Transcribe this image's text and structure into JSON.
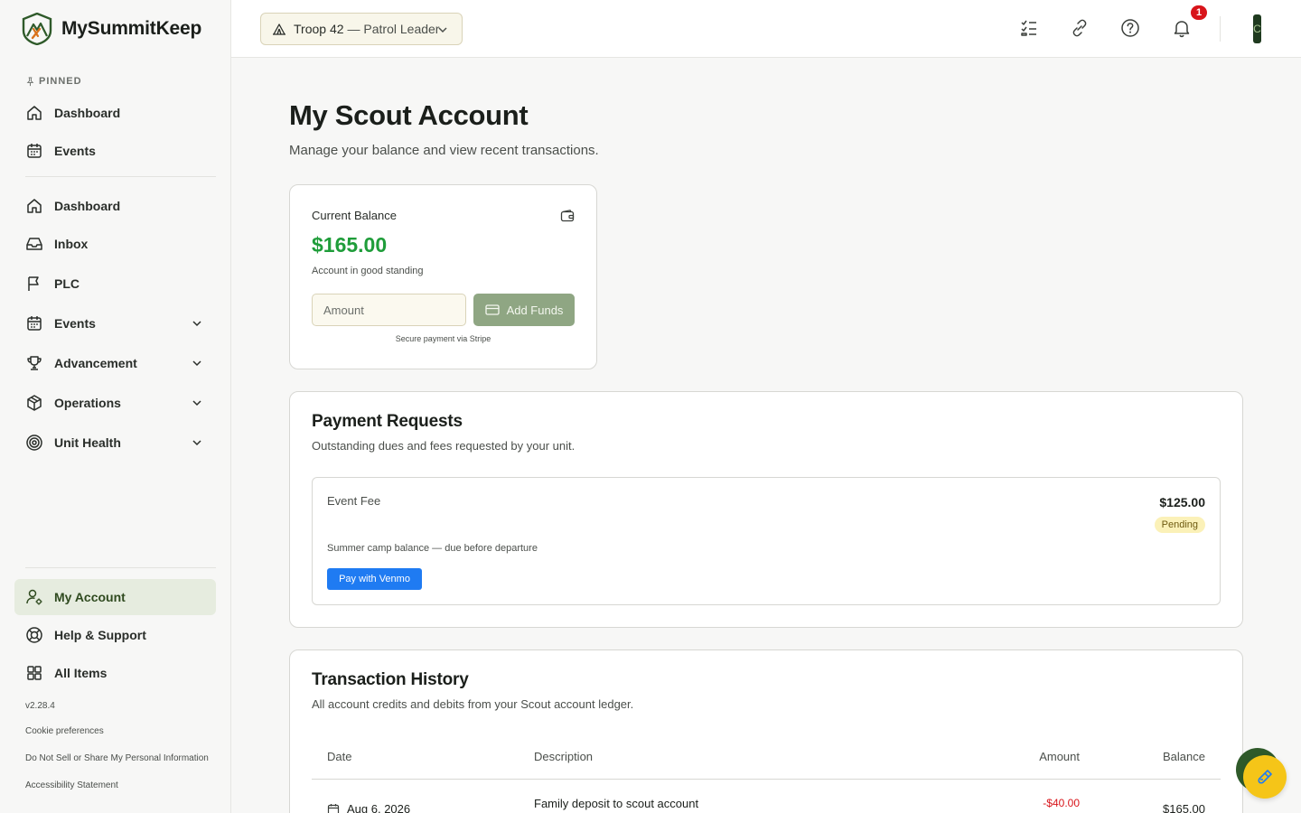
{
  "brand": {
    "name": "MySummitKeep"
  },
  "sidebar": {
    "pinned_heading": "PINNED",
    "pinned": [
      {
        "label": "Dashboard",
        "icon": "home-icon"
      },
      {
        "label": "Events",
        "icon": "calendar-icon"
      }
    ],
    "main": [
      {
        "label": "Dashboard",
        "icon": "home-icon"
      },
      {
        "label": "Inbox",
        "icon": "inbox-icon"
      },
      {
        "label": "PLC",
        "icon": "flag-icon"
      },
      {
        "label": "Events",
        "icon": "calendar-icon",
        "expandable": true
      },
      {
        "label": "Advancement",
        "icon": "trophy-icon",
        "expandable": true
      },
      {
        "label": "Operations",
        "icon": "box-icon",
        "expandable": true
      },
      {
        "label": "Unit Health",
        "icon": "target-icon",
        "expandable": true
      }
    ],
    "bottom": [
      {
        "label": "My Account",
        "icon": "user-settings-icon",
        "active": true
      },
      {
        "label": "Help & Support",
        "icon": "lifebuoy-icon"
      },
      {
        "label": "All Items",
        "icon": "grid-icon"
      }
    ],
    "version": "v2.28.4",
    "footer_links": [
      "Cookie preferences",
      "Do Not Sell or Share My Personal Information",
      "Accessibility Statement"
    ]
  },
  "topbar": {
    "troop": "Troop 42",
    "role": "— Patrol Leader",
    "notification_count": "1",
    "avatar_initial": "C"
  },
  "main": {
    "title": "My Scout Account",
    "subtitle": "Manage your balance and view recent transactions."
  },
  "balance": {
    "label": "Current Balance",
    "amount": "$165.00",
    "status": "Account in good standing",
    "amount_placeholder": "Amount",
    "add_funds_label": "Add Funds",
    "secure_note": "Secure payment via Stripe"
  },
  "payment_requests": {
    "title": "Payment Requests",
    "subtitle": "Outstanding dues and fees requested by your unit.",
    "items": [
      {
        "name": "Event Fee",
        "amount": "$125.00",
        "status": "Pending",
        "description": "Summer camp balance — due before departure",
        "pay_label": "Pay with Venmo"
      }
    ]
  },
  "transactions": {
    "title": "Transaction History",
    "subtitle": "All account credits and debits from your Scout account ledger.",
    "columns": [
      "Date",
      "Description",
      "Amount",
      "Balance"
    ],
    "rows": [
      {
        "date": "Aug 6, 2026",
        "description": "Family deposit to scout account",
        "amount": "-$40.00",
        "balance": "$165.00"
      }
    ]
  },
  "colors": {
    "accent_green": "#1f9d3a",
    "brand_dark": "#2f5a2a",
    "add_funds_bg": "#8fa683",
    "venmo_blue": "#1f7bf2",
    "negative_red": "#d8141a",
    "pending_bg": "#fbf1b8"
  }
}
